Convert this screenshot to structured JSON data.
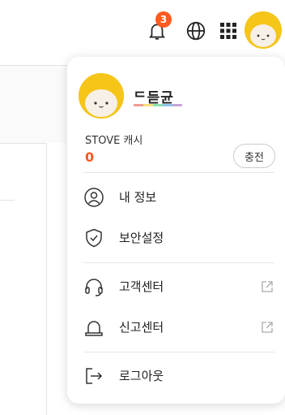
{
  "header": {
    "notification_count": "3",
    "icons": [
      "bell-icon",
      "globe-icon",
      "apps-grid-icon",
      "avatar"
    ]
  },
  "profile": {
    "nickname": "ᄃ듣균"
  },
  "cash": {
    "label": "STOVE 캐시",
    "value": "0",
    "charge_label": "충전"
  },
  "menu": {
    "items": [
      {
        "label": "내 정보",
        "icon": "user-circle-icon"
      },
      {
        "label": "보안설정",
        "icon": "shield-check-icon"
      },
      {
        "label": "고객센터",
        "icon": "headset-icon",
        "external": true
      },
      {
        "label": "신고센터",
        "icon": "siren-icon",
        "external": true
      },
      {
        "label": "로그아웃",
        "icon": "logout-icon"
      }
    ]
  },
  "colors": {
    "accent": "#ff5a1f",
    "avatar_yellow": "#f5c518"
  }
}
